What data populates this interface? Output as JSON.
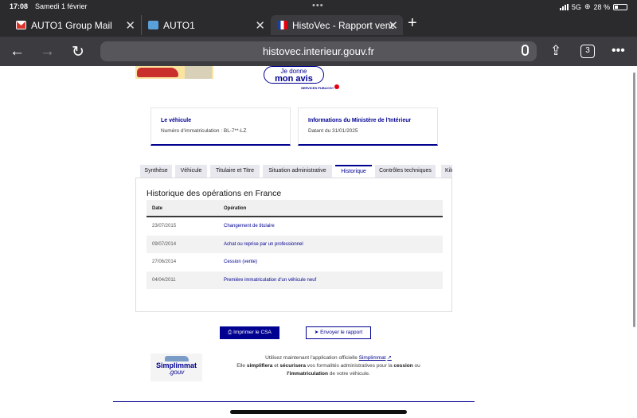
{
  "status": {
    "time": "17:08",
    "date": "Samedi 1 février",
    "network": "5G",
    "battery": "28 %"
  },
  "browser": {
    "tabs": [
      {
        "label": "AUTO1 Group Mail",
        "icon": "gmail-icon"
      },
      {
        "label": "AUTO1",
        "icon": "auto1-icon"
      },
      {
        "label": "HistoVec - Rapport vendeur",
        "icon": "french-flag-icon"
      }
    ],
    "url": "histovec.interieur.gouv.fr",
    "tab_count": "3"
  },
  "page": {
    "avis": {
      "line1": "Je donne",
      "line2": "mon avis",
      "services": "SERVICES PUBLICS+"
    },
    "vehicle_card": {
      "title": "Le véhicule",
      "value": "Numéro d'immatriculation : BL-7**-LZ"
    },
    "ministry_card": {
      "title": "Informations du Ministère de l'Intérieur",
      "value": "Datant du 31/01/2025"
    },
    "tabs": [
      "Synthèse",
      "Véhicule",
      "Titulaire et Titre",
      "Situation administrative",
      "Historique",
      "Contrôles techniques",
      "Kilométrage"
    ],
    "active_tab": "Historique",
    "history": {
      "title": "Historique des opérations en France",
      "headers": {
        "date": "Date",
        "operation": "Opération"
      },
      "rows": [
        {
          "date": "23/07/2015",
          "operation": "Changement de titulaire"
        },
        {
          "date": "09/07/2014",
          "operation": "Achat ou reprise par un professionnel"
        },
        {
          "date": "27/06/2014",
          "operation": "Cession (vente)"
        },
        {
          "date": "04/04/2011",
          "operation": "Première immatriculation d'un véhicule neuf"
        }
      ]
    },
    "actions": {
      "print": "Imprimer le CSA",
      "send": "Envoyer le rapport"
    },
    "promo": {
      "logo_word1": "Simplimmat",
      "logo_word2": ".gouv",
      "line1_a": "Utilisez maintenant l'application officielle",
      "line1_link": "Simplimmat",
      "line2_a": "Elle",
      "line2_b": "simplifiera",
      "line2_c": "et",
      "line2_d": "sécurisera",
      "line2_e": "vos formalités administratives pour la",
      "line2_f": "cession",
      "line2_g": "ou",
      "line3_a": "l'immatriculation",
      "line3_b": "de votre véhicule."
    }
  }
}
